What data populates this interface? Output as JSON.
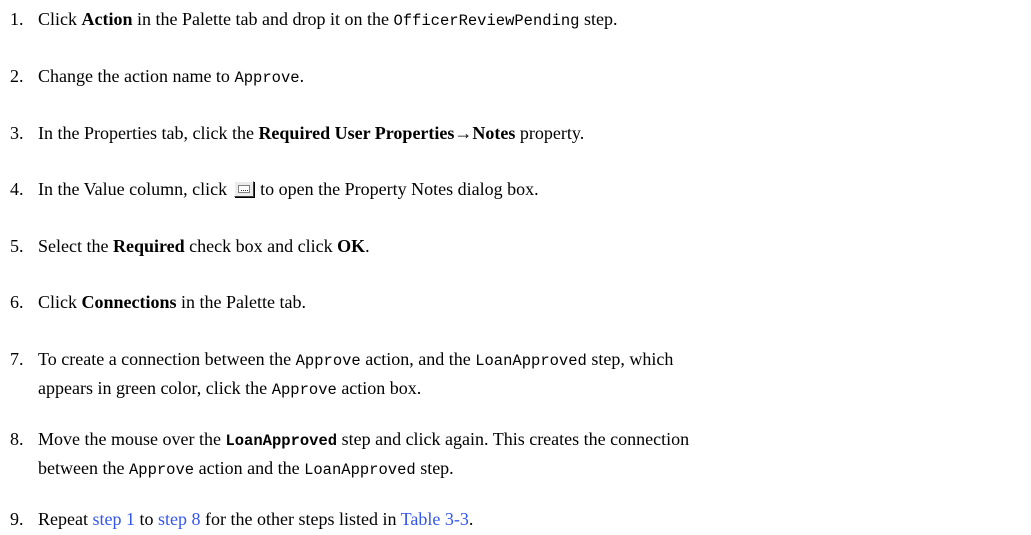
{
  "steps": [
    {
      "num": "1.",
      "parts": [
        "Click ",
        "Action",
        " in the Palette tab and drop it on the ",
        "OfficerReviewPending",
        " step."
      ]
    },
    {
      "num": "2.",
      "parts": [
        "Change the action name to ",
        "Approve",
        "."
      ]
    },
    {
      "num": "3.",
      "parts": [
        "In the Properties tab, click the ",
        "Required User Properties",
        "→",
        "Notes",
        " property."
      ]
    },
    {
      "num": "4.",
      "parts": [
        "In the Value column, click ",
        " to open the Property Notes dialog box."
      ],
      "icon": "ellipsis-button-icon"
    },
    {
      "num": "5.",
      "parts": [
        "Select the ",
        "Required",
        " check box and click ",
        "OK",
        "."
      ]
    },
    {
      "num": "6.",
      "parts": [
        "Click ",
        "Connections",
        " in the Palette tab."
      ]
    },
    {
      "num": "7.",
      "parts": [
        "To create a connection between the ",
        "Approve",
        " action, and the ",
        "LoanApproved",
        " step, which",
        "appears in green color, click the ",
        "Approve",
        " action box."
      ]
    },
    {
      "num": "8.",
      "parts": [
        "Move the mouse over the ",
        "LoanApproved",
        " step and click again. This creates the connection",
        "between the ",
        "Approve",
        " action and the ",
        "LoanApproved",
        " step."
      ]
    },
    {
      "num": "9.",
      "parts": [
        "Repeat ",
        "step 1",
        " to ",
        "step 8",
        " for the other steps listed in ",
        "Table 3-3",
        "."
      ]
    }
  ],
  "colors": {
    "text": "#000000",
    "link": "#3355ee",
    "background": "#ffffff"
  }
}
